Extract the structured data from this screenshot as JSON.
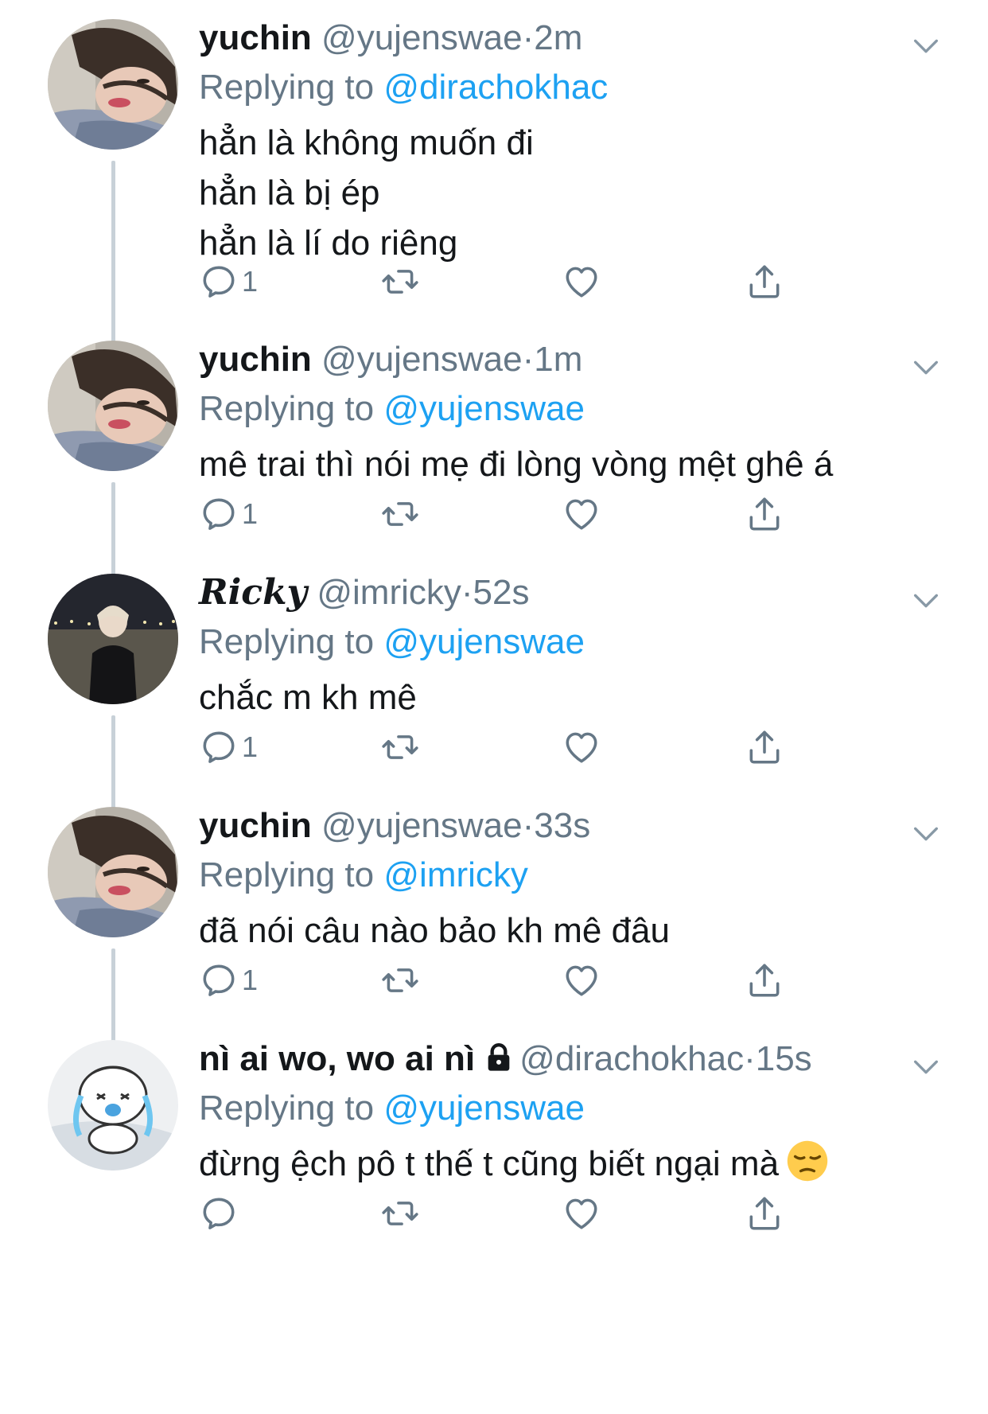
{
  "replying_prefix": "Replying to",
  "tweets": [
    {
      "name": "yuchin",
      "handle": "@yujenswae",
      "separator": "·",
      "time": "2m",
      "reply_to": "@dirachokhac",
      "lines": [
        "hẳn là không muốn đi",
        "hẳn là bị ép",
        "hẳn là lí do riêng"
      ],
      "reply_count": "1",
      "avatar": "yuchin-avatar"
    },
    {
      "name": "yuchin",
      "handle": "@yujenswae",
      "separator": "·",
      "time": "1m",
      "reply_to": "@yujenswae",
      "lines": [
        "mê trai thì nói mẹ đi lòng vòng mệt ghê á"
      ],
      "reply_count": "1",
      "avatar": "yuchin-avatar"
    },
    {
      "name": "Ricky",
      "handle": "@imricky",
      "separator": "·",
      "time": "52s",
      "reply_to": "@yujenswae",
      "lines": [
        "chắc m kh mê"
      ],
      "reply_count": "1",
      "avatar": "ricky-avatar"
    },
    {
      "name": "yuchin",
      "handle": "@yujenswae",
      "separator": "·",
      "time": "33s",
      "reply_to": "@imricky",
      "lines": [
        "đã nói câu nào bảo kh mê đâu"
      ],
      "reply_count": "1",
      "avatar": "yuchin-avatar"
    },
    {
      "name": "nì ai wo, wo ai nì",
      "handle": "@dirachokhac",
      "separator": "·",
      "time": "15s",
      "reply_to": "@yujenswae",
      "lines": [
        "đừng ệch pô t thế t cũng biết ngại mà"
      ],
      "reply_count": "",
      "avatar": "cartoon-avatar",
      "locked": true,
      "emoji": "pensive-face-emoji"
    }
  ],
  "colors": {
    "text": "#14171a",
    "secondary": "#657786",
    "link": "#1da1f2",
    "thread_line": "#c8d1d8"
  },
  "icons": [
    "reply-icon",
    "retweet-icon",
    "like-icon",
    "share-icon",
    "chevron-down-icon",
    "lock-icon"
  ]
}
